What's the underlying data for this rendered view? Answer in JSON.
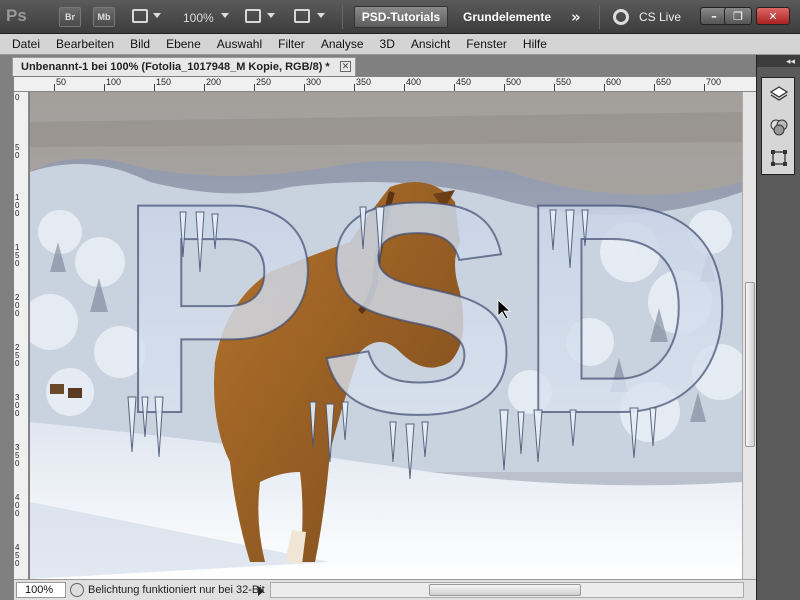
{
  "app": {
    "logo": "Ps",
    "bridge_label": "Br",
    "minibridge_label": "Mb",
    "zoom": "100%",
    "workspace_active": "PSD-Tutorials",
    "workspace_other": "Grundelemente",
    "more": "»",
    "cslive": "CS Live",
    "win_min": "–",
    "win_restore": "❐",
    "win_close": "✕"
  },
  "menu": [
    "Datei",
    "Bearbeiten",
    "Bild",
    "Ebene",
    "Auswahl",
    "Filter",
    "Analyse",
    "3D",
    "Ansicht",
    "Fenster",
    "Hilfe"
  ],
  "document": {
    "tab_title": "Unbenannt-1 bei 100% (Fotolia_1017948_M Kopie, RGB/8) *",
    "tab_close": "✕",
    "canvas_text": "PSD",
    "ruler_h_labels": [
      "50",
      "100",
      "150",
      "200",
      "250",
      "300",
      "350",
      "400",
      "450",
      "500",
      "550",
      "600",
      "650",
      "700"
    ],
    "ruler_v_labels": [
      "0",
      "50",
      "100",
      "150",
      "200",
      "250",
      "300",
      "350",
      "400",
      "450",
      "500"
    ]
  },
  "status": {
    "zoom": "100%",
    "text": "Belichtung funktioniert nur bei 32-Bit"
  },
  "panel": {
    "collapse": "◂◂",
    "icons": [
      "layers-icon",
      "channels-icon",
      "transform-icon"
    ]
  }
}
